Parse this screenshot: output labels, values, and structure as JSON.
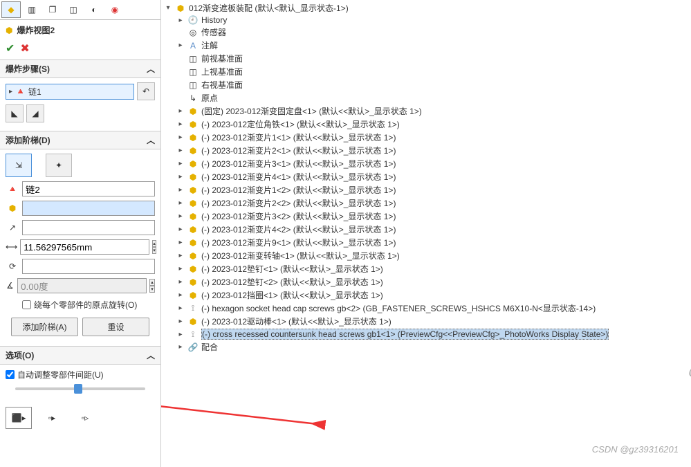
{
  "left": {
    "title": "爆炸视图2",
    "section_steps": "爆炸步骤(S)",
    "step1": "链1",
    "section_add": "添加阶梯(D)",
    "chain2": "链2",
    "distance": "11.56297565mm",
    "angle_placeholder": "0.00度",
    "rotate_checkbox": "绕每个零部件的原点旋转(O)",
    "btn_add": "添加阶梯(A)",
    "btn_reset": "重设",
    "section_options": "选项(O)",
    "auto_adjust": "自动调整零部件间距(U)"
  },
  "tree": {
    "root": "012渐变遮板装配  (默认<默认_显示状态-1>)",
    "history": "History",
    "sensor": "传感器",
    "annotation": "注解",
    "front_plane": "前视基准面",
    "top_plane": "上视基准面",
    "right_plane": "右视基准面",
    "origin": "原点",
    "parts": [
      "(固定) 2023-012渐变固定盘<1>  (默认<<默认>_显示状态 1>)",
      "(-) 2023-012定位角铁<1>  (默认<<默认>_显示状态 1>)",
      "(-) 2023-012渐变片1<1>  (默认<<默认>_显示状态 1>)",
      "(-) 2023-012渐变片2<1>  (默认<<默认>_显示状态 1>)",
      "(-) 2023-012渐变片3<1>  (默认<<默认>_显示状态 1>)",
      "(-) 2023-012渐变片4<1>  (默认<<默认>_显示状态 1>)",
      "(-) 2023-012渐变片1<2>  (默认<<默认>_显示状态 1>)",
      "(-) 2023-012渐变片2<2>  (默认<<默认>_显示状态 1>)",
      "(-) 2023-012渐变片3<2>  (默认<<默认>_显示状态 1>)",
      "(-) 2023-012渐变片4<2>  (默认<<默认>_显示状态 1>)",
      "(-) 2023-012渐变片9<1>  (默认<<默认>_显示状态 1>)",
      "(-) 2023-012渐变转轴<1>  (默认<<默认>_显示状态 1>)",
      "(-) 2023-012垫钉<1>  (默认<<默认>_显示状态 1>)",
      "(-) 2023-012垫钉<2>  (默认<<默认>_显示状态 1>)",
      "(-) 2023-012挡圈<1>  (默认<<默认>_显示状态 1>)"
    ],
    "screw1": "(-) hexagon socket head cap screws gb<2>  (GB_FASTENER_SCREWS_HSHCS M6X10-N<显示状态-14>)",
    "drive_rod": "(-) 2023-012驱动棒<1>  (默认<<默认>_显示状态 1>)",
    "screw2": "(-) cross recessed countersunk head screws gb1<1>  (PreviewCfg<<PreviewCfg>_PhotoWorks Display State>)",
    "mates": "配合"
  },
  "watermark": "CSDN @gz39316201"
}
